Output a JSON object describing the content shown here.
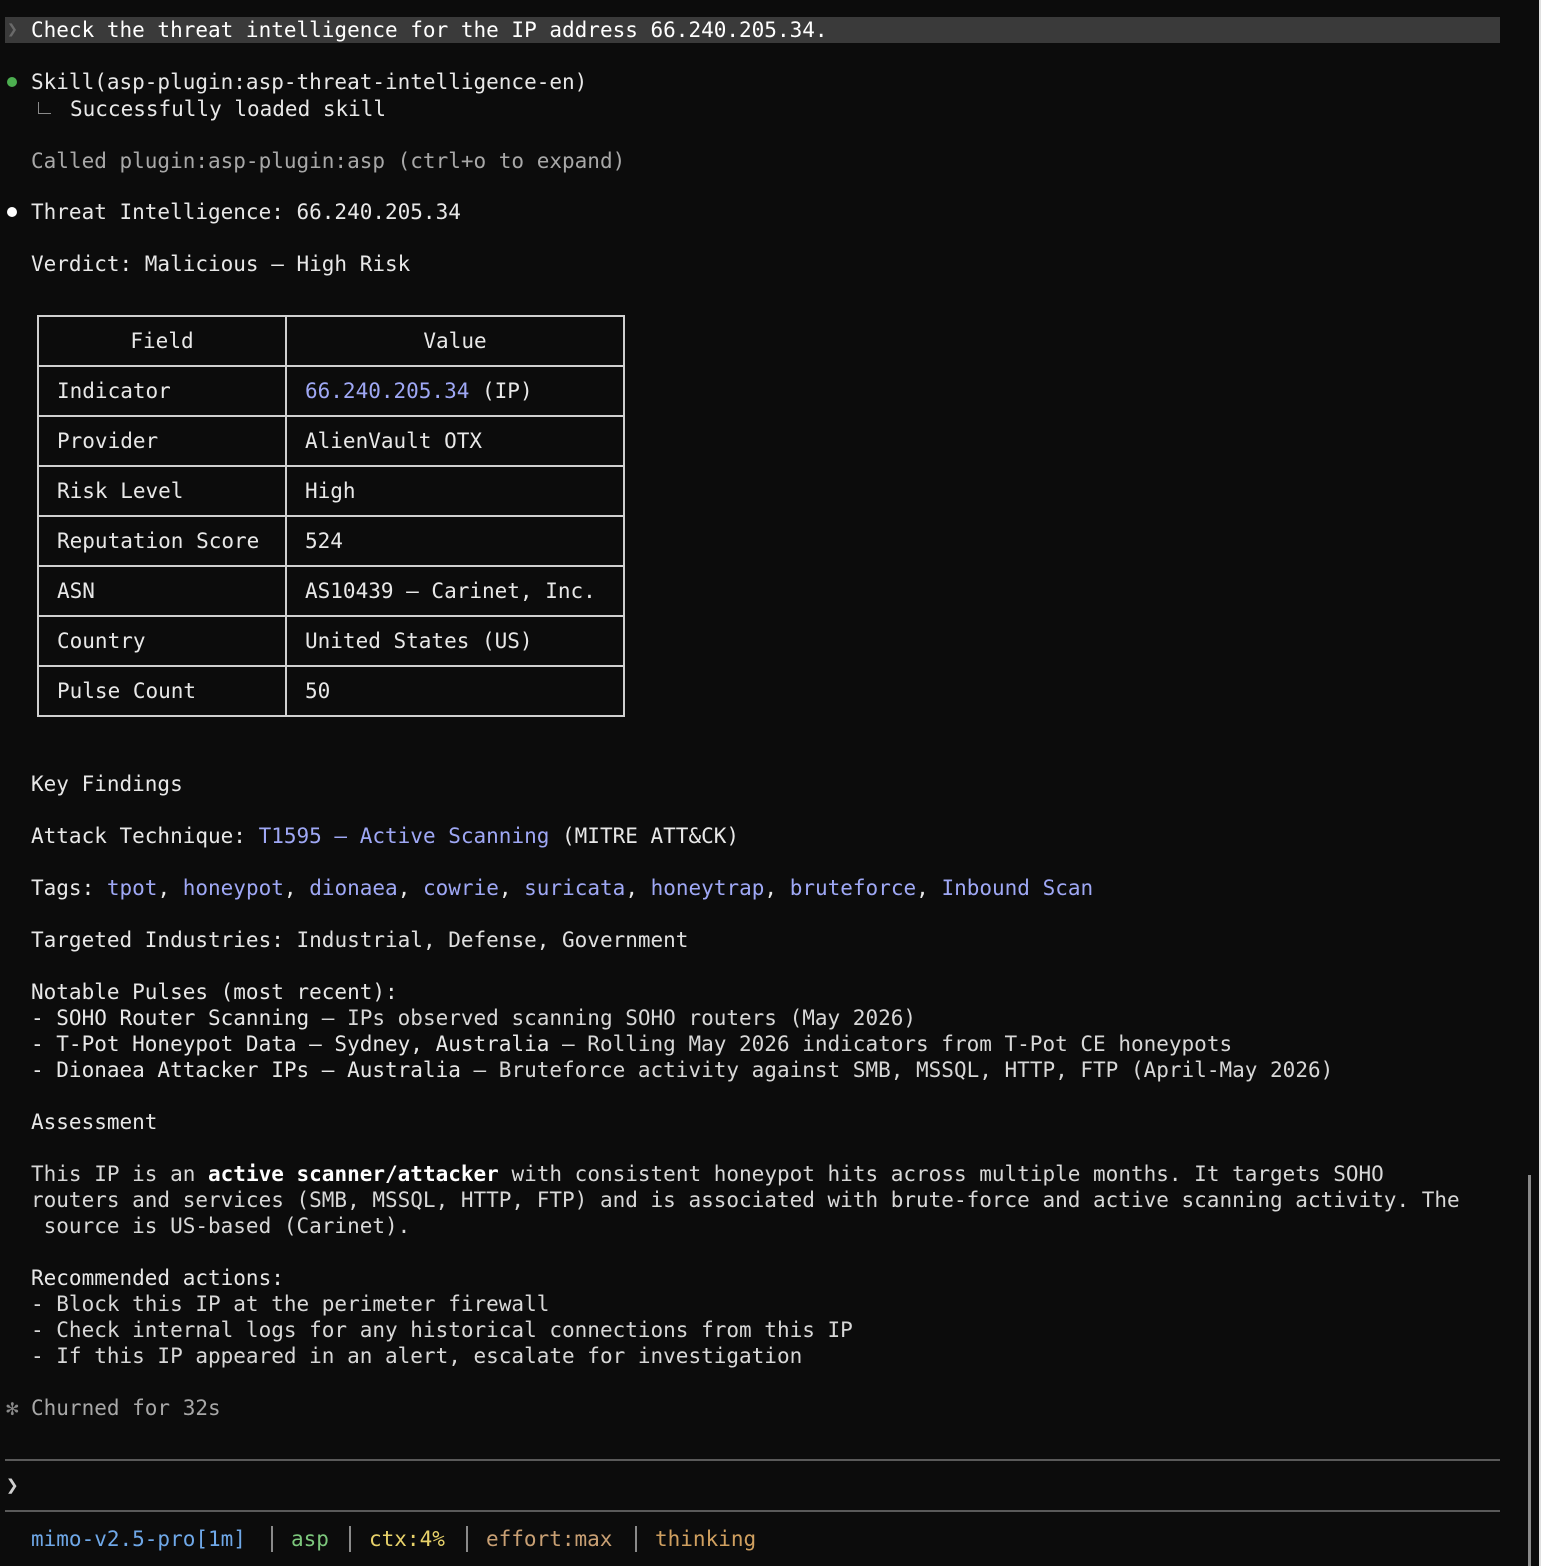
{
  "prompt": {
    "text": "Check the threat intelligence for the IP address 66.240.205.34."
  },
  "skill": {
    "call": "Skill(asp-plugin:asp-threat-intelligence-en)",
    "result": "Successfully loaded skill"
  },
  "plugin_call": "Called plugin:asp-plugin:asp (ctrl+o to expand)",
  "heading": "Threat Intelligence: 66.240.205.34",
  "verdict": "Verdict: Malicious — High Risk",
  "table": {
    "headers": [
      "Field",
      "Value"
    ],
    "indicator_label": "Indicator",
    "indicator_ip": "66.240.205.34",
    "indicator_type": " (IP)",
    "rows": [
      {
        "field": "Provider",
        "value": "AlienVault OTX"
      },
      {
        "field": "Risk Level",
        "value": "High"
      },
      {
        "field": "Reputation Score",
        "value": "524"
      },
      {
        "field": "ASN",
        "value": "AS10439 — Carinet, Inc."
      },
      {
        "field": "Country",
        "value": "United States (US)"
      },
      {
        "field": "Pulse Count",
        "value": "50"
      }
    ]
  },
  "findings": {
    "title": "Key Findings",
    "attack_label": "Attack Technique: ",
    "attack_link": "T1595 — Active Scanning",
    "attack_suffix": " (MITRE ATT&CK)",
    "tags_label": "Tags: ",
    "tags": [
      "tpot",
      "honeypot",
      "dionaea",
      "cowrie",
      "suricata",
      "honeytrap",
      "bruteforce",
      "Inbound Scan"
    ],
    "industries_label": "Targeted Industries: ",
    "industries": "Industrial, Defense, Government",
    "pulses_title": "Notable Pulses (most recent):",
    "pulses": [
      {
        "name": "- SOHO Router Scanning",
        "desc": " — IPs observed scanning SOHO routers (May 2026)"
      },
      {
        "name": "- T-Pot Honeypot Data — Sydney, Australia",
        "desc": " — Rolling May 2026 indicators from T-Pot CE honeypots"
      },
      {
        "name": "- Dionaea Attacker IPs — Australia",
        "desc": " — Bruteforce activity against SMB, MSSQL, HTTP, FTP (April-May 2026)"
      }
    ]
  },
  "assessment": {
    "title": "Assessment",
    "line1_a": "This IP is an ",
    "line1_b": "active scanner/attacker",
    "line1_c": " with consistent honeypot hits across multiple months. It targets SOHO",
    "line2": "routers and services (SMB, MSSQL, HTTP, FTP) and is associated with brute-force and active scanning activity. The",
    "line3": " source is US-based (Carinet)."
  },
  "recommended": {
    "title": "Recommended actions:",
    "items": [
      "- Block this IP at the perimeter firewall",
      "- Check internal logs for any historical connections from this IP",
      "- If this IP appeared in an alert, escalate for investigation"
    ]
  },
  "churn": "Churned for 32s",
  "input": {
    "chevron": "❯",
    "value": ""
  },
  "statusbar": {
    "model": "mimo-v2.5-pro[1m]",
    "plugin": "asp",
    "ctx": "ctx:4%",
    "effort": "effort:max",
    "mode": "thinking"
  },
  "colors": {
    "background": "#0c0c0c",
    "link": "#9fa8f5",
    "model": "#6fa8e8",
    "plugin": "#7dc87d",
    "ctx": "#e8d26a",
    "effort": "#c9a074",
    "thinking": "#d0a060"
  }
}
